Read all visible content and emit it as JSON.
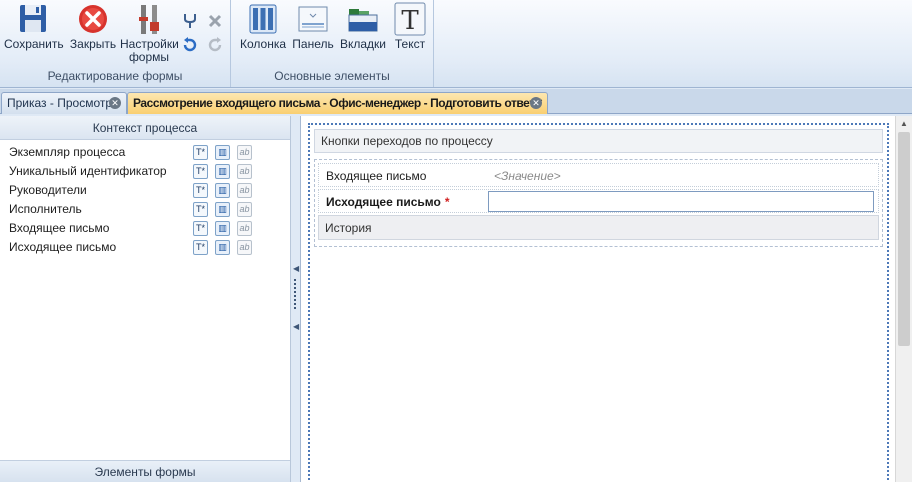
{
  "ribbon": {
    "groups": [
      {
        "label": "Редактирование формы",
        "buttons": [
          {
            "label": "Сохранить",
            "icon": "floppy-disk-icon"
          },
          {
            "label": "Закрыть",
            "icon": "red-close-circle-icon"
          },
          {
            "label": "Настройки формы",
            "icon": "settings-tools-icon"
          }
        ],
        "small_buttons": [
          "fork-icon",
          "undo-icon",
          "delete-icon",
          "redo-icon"
        ]
      },
      {
        "label": "Основные элементы",
        "buttons": [
          {
            "label": "Колонка",
            "icon": "column-icon"
          },
          {
            "label": "Панель",
            "icon": "panel-icon"
          },
          {
            "label": "Вкладки",
            "icon": "tabs-icon"
          },
          {
            "label": "Текст",
            "icon": "text-T-icon"
          }
        ]
      }
    ]
  },
  "tabs": [
    {
      "label": "Приказ - Просмотр",
      "active": false
    },
    {
      "label": "Рассмотрение входящего письма - Офис-менеджер - Подготовить ответ *",
      "active": true
    }
  ],
  "left_panel": {
    "header": "Контекст процесса",
    "rows": [
      {
        "label": "Экземпляр процесса"
      },
      {
        "label": "Уникальный идентификатор"
      },
      {
        "label": "Руководители"
      },
      {
        "label": "Исполнитель"
      },
      {
        "label": "Входящее письмо"
      },
      {
        "label": "Исходящее письмо"
      }
    ],
    "row_actions": {
      "text_badge": "T*",
      "ab_badge": "ab"
    },
    "footer": "Элементы формы"
  },
  "canvas": {
    "button_bar": "Кнопки переходов по процессу",
    "fields": [
      {
        "label": "Входящее письмо",
        "value_placeholder": "<Значение>",
        "bold": false
      },
      {
        "label": "Исходящее письмо",
        "required_mark": "*",
        "bold": true,
        "value": ""
      }
    ],
    "history_label": "История"
  },
  "colors": {
    "active_tab": "#f9cf71",
    "design_border": "#4d79b8",
    "required": "#d12020"
  }
}
